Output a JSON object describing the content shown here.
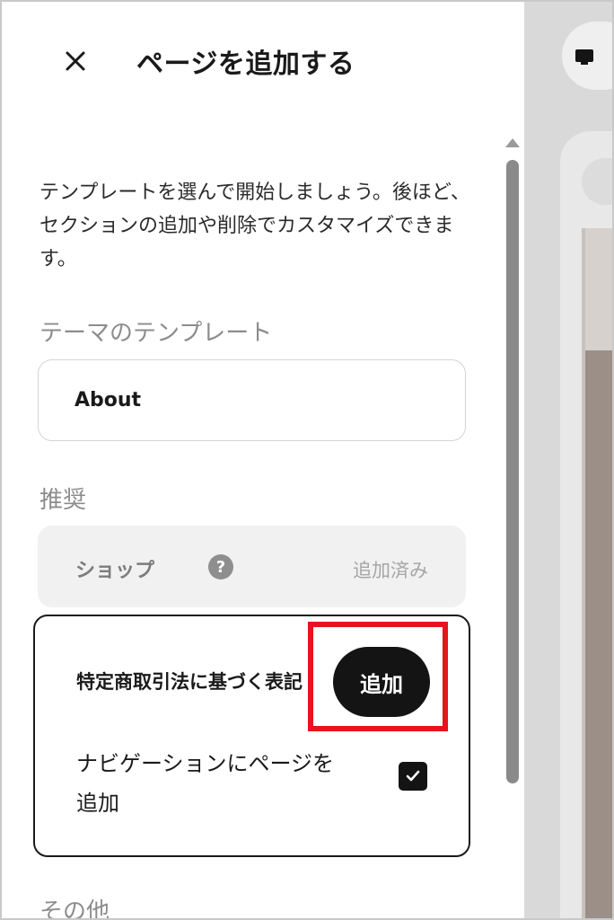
{
  "header": {
    "close_icon": "close-icon",
    "title": "ページを追加する"
  },
  "intro": {
    "text": "テンプレートを選んで開始しましょう。後ほど、セクションの追加や削除でカスタマイズできます。"
  },
  "theme_templates": {
    "label": "テーマのテンプレート",
    "items": [
      {
        "name": "About"
      }
    ]
  },
  "recommended": {
    "label": "推奨",
    "shop": {
      "name": "ショップ",
      "help_icon": "?",
      "status": "追加済み"
    },
    "legal": {
      "name": "特定商取引法に基づく表記",
      "add_label": "追加",
      "nav_option_label": "ナビゲーションにページを追加",
      "nav_option_checked": true
    }
  },
  "other": {
    "label": "その他"
  },
  "preview": {
    "device_icon": "desktop-icon"
  },
  "colors": {
    "highlight": "#e8141b",
    "primary_button": "#141414",
    "muted_text": "#8c8c8c"
  }
}
